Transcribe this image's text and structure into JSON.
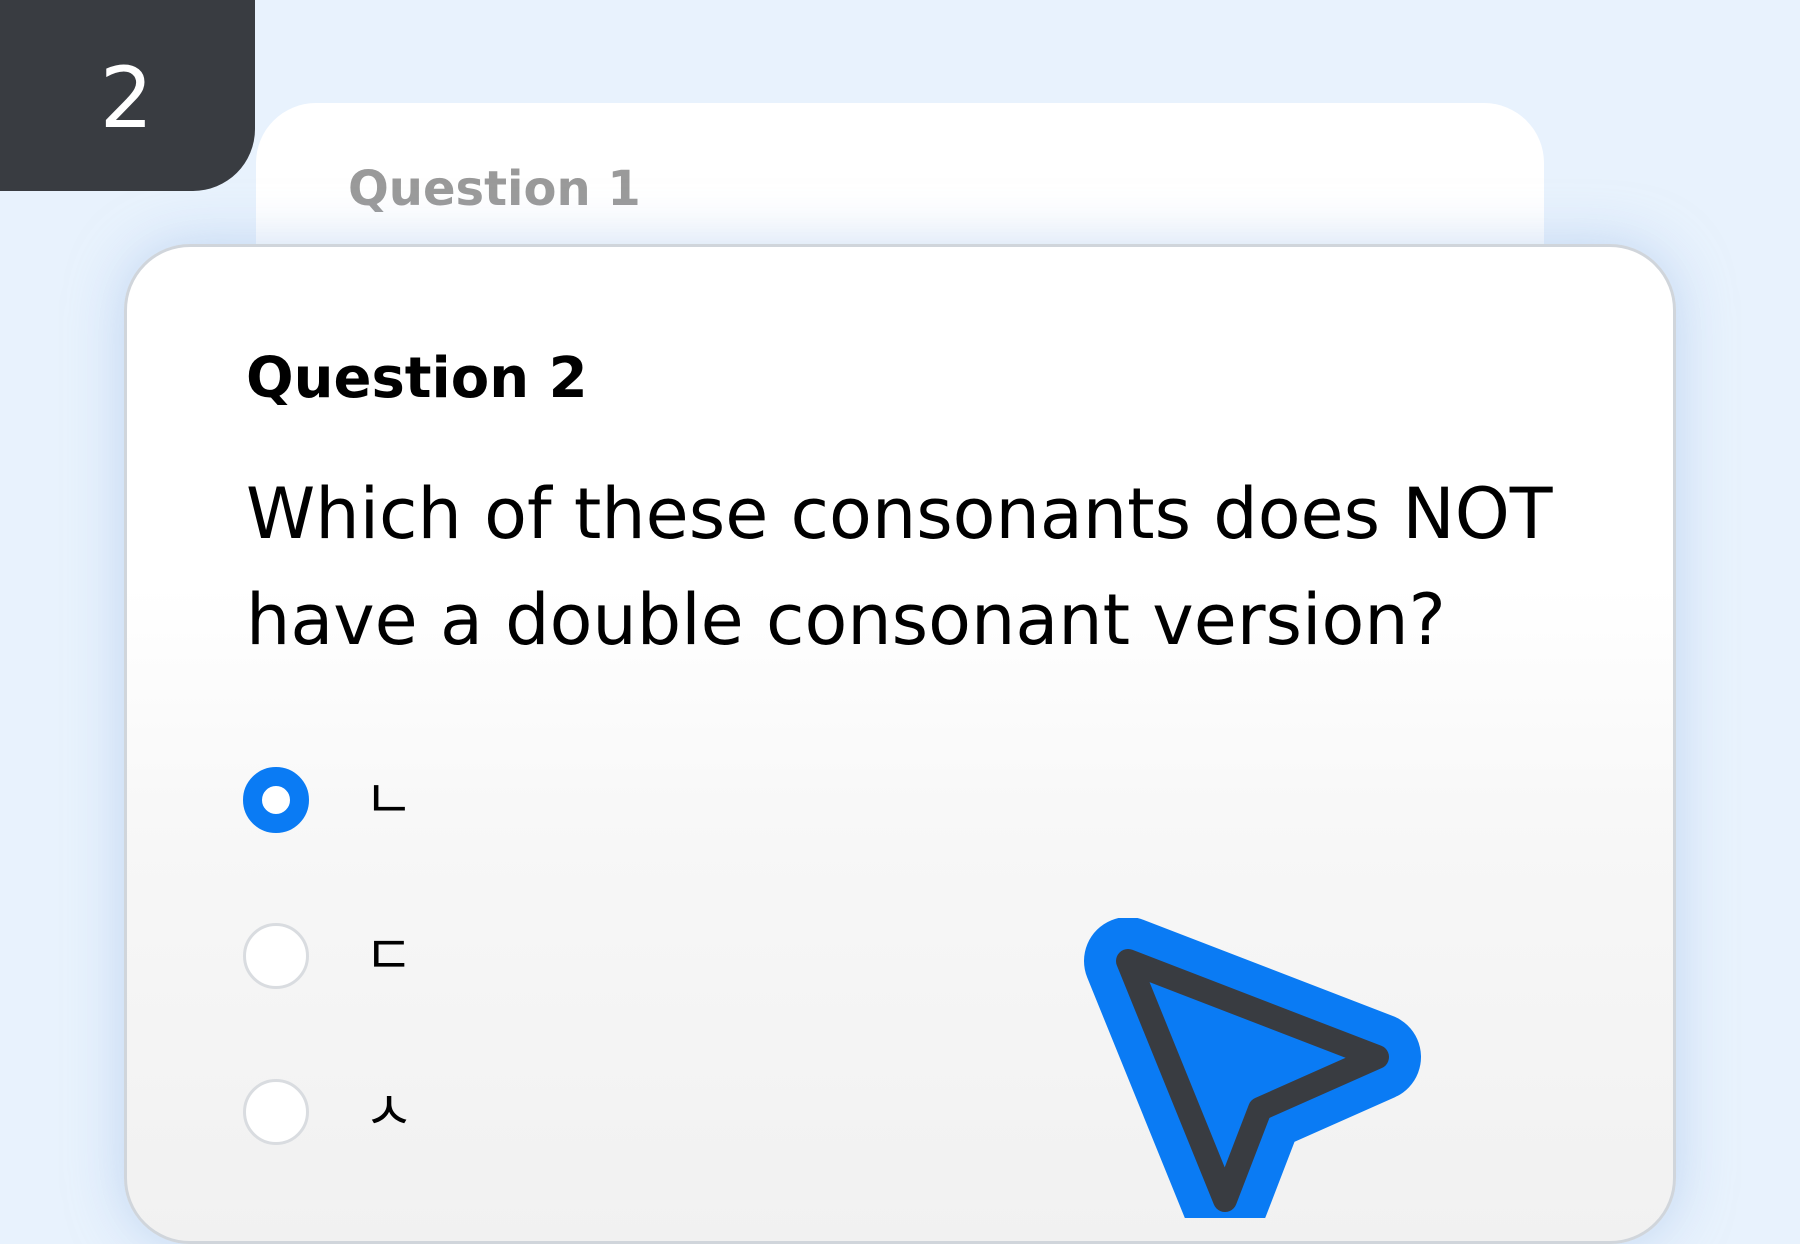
{
  "step": {
    "number": "2"
  },
  "previous_question": {
    "title": "Question 1"
  },
  "current_question": {
    "title": "Question 2",
    "text": "Which of these consonants does NOT have a double consonant version?",
    "options": [
      {
        "label": "ㄴ",
        "selected": true
      },
      {
        "label": "ㄷ",
        "selected": false
      },
      {
        "label": "ㅅ",
        "selected": false
      }
    ]
  },
  "cursor": {
    "icon": "pointer-arrow-icon",
    "fill_color": "#0a7bf4",
    "outline_color": "#393c41"
  },
  "colors": {
    "background": "#e8f2fd",
    "accent": "#0a7bf4",
    "badge": "#393c41"
  }
}
